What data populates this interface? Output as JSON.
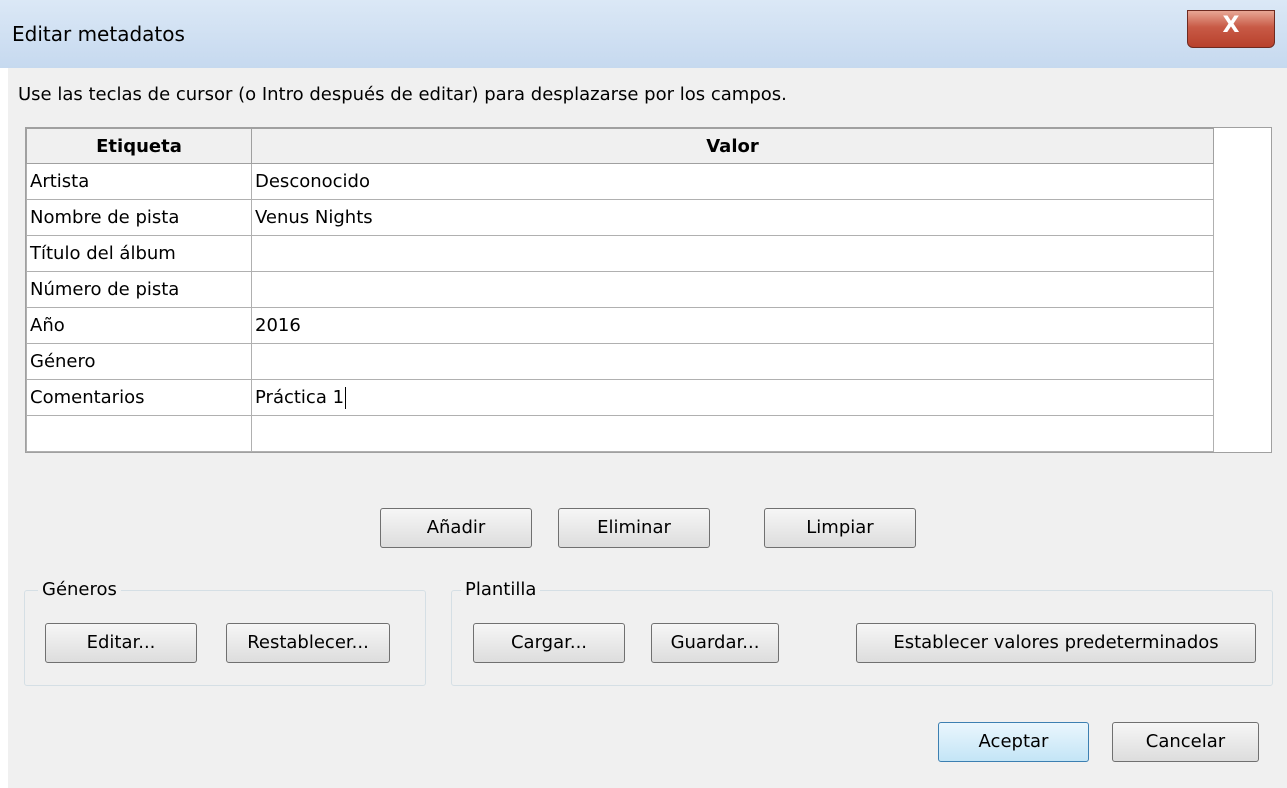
{
  "window": {
    "title": "Editar metadatos",
    "close_glyph": "X",
    "close_icon": "close-icon"
  },
  "hint": "Use las teclas de cursor (o Intro después de editar) para desplazarse por los campos.",
  "table": {
    "headers": [
      "Etiqueta",
      "Valor"
    ],
    "rows": [
      {
        "label": "Artista",
        "value": "Desconocido"
      },
      {
        "label": "Nombre de pista",
        "value": "Venus Nights"
      },
      {
        "label": "Título del álbum",
        "value": ""
      },
      {
        "label": "Número de pista",
        "value": ""
      },
      {
        "label": "Año",
        "value": "2016"
      },
      {
        "label": "Género",
        "value": ""
      },
      {
        "label": "Comentarios",
        "value": "Práctica 1"
      },
      {
        "label": "",
        "value": ""
      }
    ]
  },
  "edit_buttons": {
    "add": "Añadir",
    "remove": "Eliminar",
    "clear": "Limpiar"
  },
  "genres": {
    "label": "Géneros",
    "edit": "Editar...",
    "reset": "Restablecer..."
  },
  "template": {
    "label": "Plantilla",
    "load": "Cargar...",
    "save": "Guardar...",
    "set_default": "Establecer valores predeterminados"
  },
  "dialog": {
    "ok": "Aceptar",
    "cancel": "Cancelar"
  }
}
